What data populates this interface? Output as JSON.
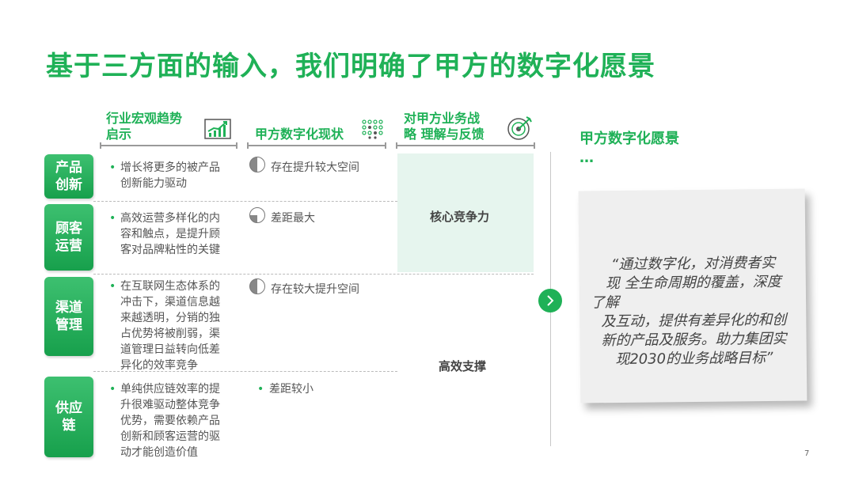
{
  "title": "基于三方面的输入，我们明确了甲方的数字化愿景",
  "columns": [
    {
      "line1": "行业宏观趋势",
      "line2": "启示",
      "icon": "trend-chart-icon"
    },
    {
      "line1": "甲方数字化现状",
      "icon": "dot-grid-icon"
    },
    {
      "line1": "对甲方业务战",
      "line2": "略 理解与反馈",
      "icon": "target-icon"
    },
    {
      "line1": "甲方数字化愿景",
      "line2": "…"
    }
  ],
  "rows": [
    {
      "label_lines": [
        "产品",
        "创新"
      ],
      "trend_lines": [
        "增长将更多的被产品",
        "创新能力驱动"
      ],
      "status": "存在提升较大空间",
      "status_fill": 0.5
    },
    {
      "label_lines": [
        "顾客",
        "运营"
      ],
      "trend_lines": [
        "高效运营多样化的内",
        "容和触点，是提升顾",
        "客对品牌粘性的关键"
      ],
      "status": "差距最大",
      "status_fill": 0.25
    },
    {
      "label_lines": [
        "渠道",
        "管理"
      ],
      "trend_lines": [
        "在互联网生态体系的",
        "冲击下，渠道信息越",
        "来越透明，分销的独",
        "占优势将被削弱，渠",
        "道管理日益转向低差",
        "异化的效率竞争"
      ],
      "status": "存在较大提升空间",
      "status_fill": 0.5
    },
    {
      "label_lines": [
        "供应链"
      ],
      "trend_lines": [
        "单纯供应链效率的提",
        "升很难驱动整体竞争",
        "优势，需要依赖产品",
        "创新和顾客运营的驱",
        "动才能创造价值"
      ],
      "status": "差距较小",
      "status_fill": 0
    }
  ],
  "capabilities": {
    "core": "核心竞争力",
    "support": "高效支撑"
  },
  "vision_lines": [
    "“通过数字化，对消费者实",
    "现 全生命周期的覆盖，深度",
    "了解",
    "及互动，提供有差异化的和创",
    "新的产品及服务。助力集团实",
    "现2030的业务战略目标”"
  ],
  "page_number": "7",
  "colors": {
    "brand_green": "#1fb157",
    "light_green": "#e6f5ee",
    "pie_fill": "#888888"
  }
}
